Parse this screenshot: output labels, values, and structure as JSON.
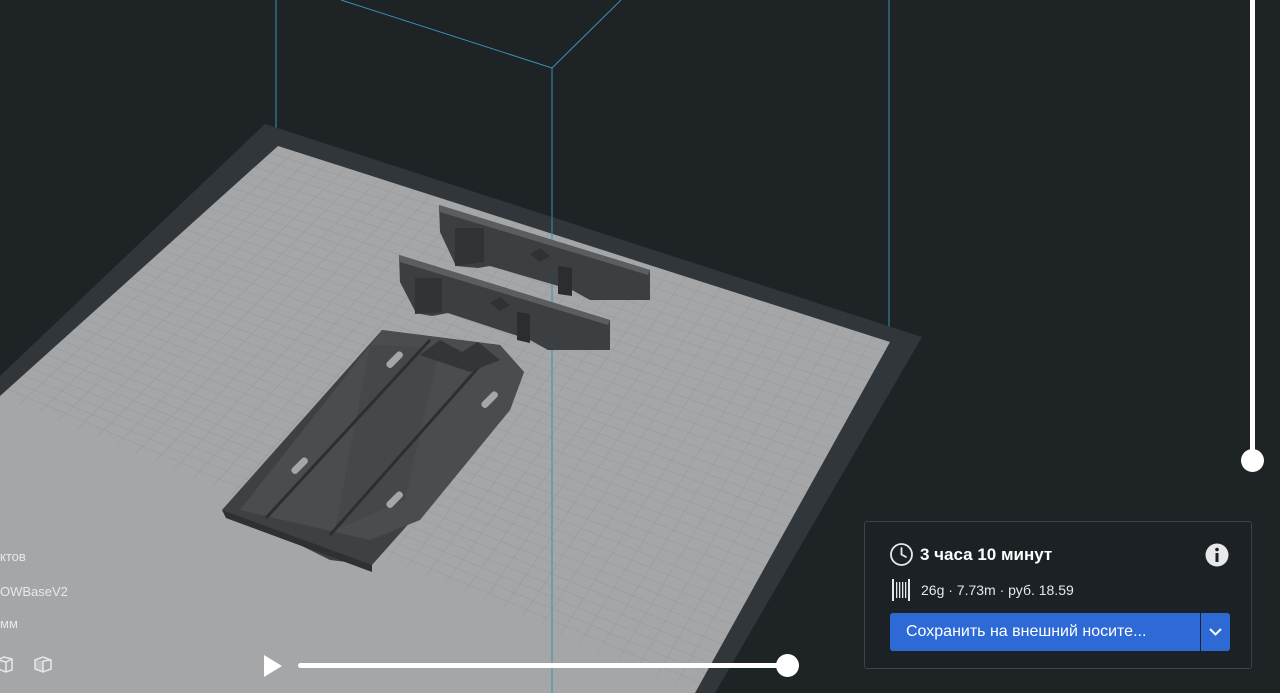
{
  "scene": {
    "background_color": "#1e2326",
    "plate_color": "#a4a6a7",
    "plate_frame_color": "#31363a",
    "grid_color": "#8f9193",
    "volume_line_color": "#3e8fb3",
    "model_color": "#4a4d4f"
  },
  "left_info": {
    "objects_text": "ктов",
    "model_name": "OWBaseV2",
    "size_unit": " мм"
  },
  "icons": {
    "view_cube_a": "view-cube-front-icon",
    "view_cube_b": "view-cube-side-icon",
    "play": "play-icon",
    "clock": "clock-icon",
    "info": "info-icon",
    "filament": "filament-spool-icon",
    "dropdown": "chevron-down-icon"
  },
  "simulation": {
    "progress": 1.0
  },
  "layer_view": {
    "current_layer_fraction": 0.0
  },
  "print_panel": {
    "time": "3 часа 10 минут",
    "material_summary": "26g · 7.73m · руб. 18.59",
    "save_label": "Сохранить на внешний носите...",
    "accent_color": "#2e6ad6"
  }
}
